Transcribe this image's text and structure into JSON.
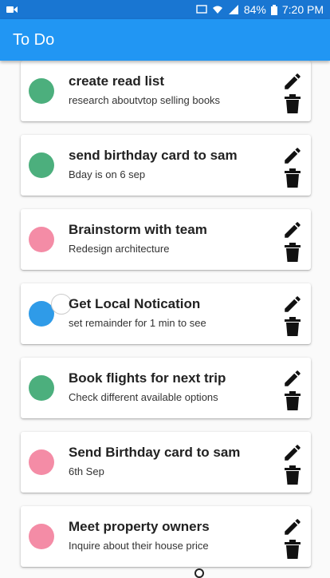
{
  "status": {
    "percent": "84%",
    "time": "7:20 PM"
  },
  "appbar": {
    "title": "To Do"
  },
  "colors": {
    "green": "#4caf7d",
    "pink": "#f48ca6",
    "blue": "#2f9be8"
  },
  "tasks": [
    {
      "title": "create read list",
      "subtitle": "research aboutvtop selling books",
      "color": "#4caf7d"
    },
    {
      "title": "send birthday card to sam",
      "subtitle": "Bday is on 6 sep",
      "color": "#4caf7d"
    },
    {
      "title": "Brainstorm with team",
      "subtitle": "Redesign architecture",
      "color": "#f48ca6"
    },
    {
      "title": "Get Local Notication",
      "subtitle": "set remainder for 1 min to see",
      "color": "#2f9be8"
    },
    {
      "title": "Book flights for next trip",
      "subtitle": "Check different available options",
      "color": "#4caf7d"
    },
    {
      "title": "Send Birthday card to sam",
      "subtitle": "6th Sep",
      "color": "#f48ca6"
    },
    {
      "title": "Meet property owners",
      "subtitle": "Inquire about their house price",
      "color": "#f48ca6"
    }
  ]
}
